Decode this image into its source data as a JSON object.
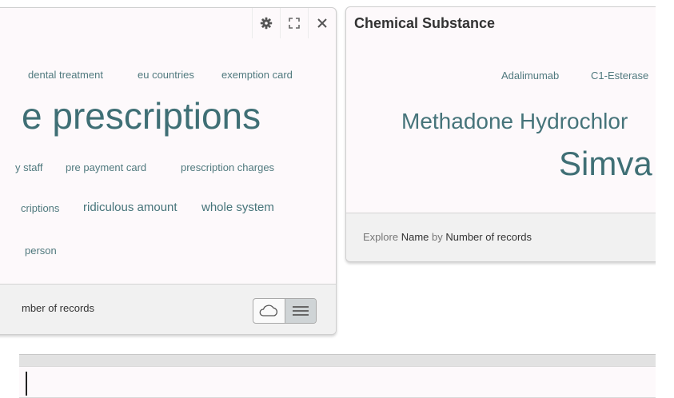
{
  "left_panel": {
    "cloud": {
      "row1": [
        "dental treatment",
        "eu countries",
        "exemption card"
      ],
      "big": "e prescriptions",
      "row2": [
        "y staff",
        "pre payment card",
        "prescription charges"
      ],
      "row3": [
        "criptions",
        "ridiculous amount",
        "whole system"
      ],
      "row4": [
        "person"
      ]
    },
    "footer": {
      "text": "mber of records"
    }
  },
  "right_panel": {
    "title": "Chemical Substance",
    "cloud": {
      "row1": [
        "Adalimumab",
        "C1-Esterase"
      ],
      "mid": "Methadone Hydrochlor",
      "big": "Simva"
    },
    "footer": {
      "explore": "Explore",
      "field": "Name",
      "by": "by",
      "measure": "Number of records"
    }
  },
  "icons": {
    "settings": "gear-icon",
    "expand": "expand-icon",
    "close": "close-icon",
    "cloud_view": "cloud-icon",
    "list_view": "list-icon"
  },
  "colors": {
    "cloud_text": "#3f6f75",
    "panel_bg": "#fdf9fb",
    "footer_bg": "#f1f1f1"
  }
}
